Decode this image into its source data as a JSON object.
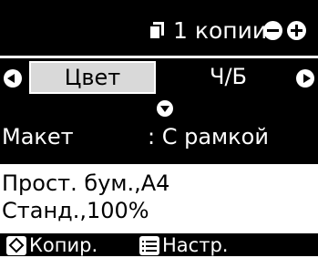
{
  "header": {
    "copies_icon": "copy-pages-icon",
    "copies_text": "1 копии",
    "minus_icon": "minus-icon",
    "plus_icon": "plus-icon"
  },
  "color_mode": {
    "options": [
      "Цвет",
      "Ч/Б"
    ],
    "selected": "Цвет",
    "left_icon": "arrow-left-icon",
    "right_icon": "arrow-right-icon",
    "down_icon": "arrow-down-icon"
  },
  "layout": {
    "label": "Макет",
    "value": ": С рамкой"
  },
  "paper": {
    "line1": "Прост. бум.,A4",
    "line2": "Станд.,100%"
  },
  "softkeys": {
    "copy_icon": "start-diamond-icon",
    "copy_label": "Копир.",
    "settings_icon": "menu-list-icon",
    "settings_label": "Настр."
  },
  "colors": {
    "background": "#000000",
    "foreground": "#ffffff",
    "highlight": "#d9d9d9"
  }
}
